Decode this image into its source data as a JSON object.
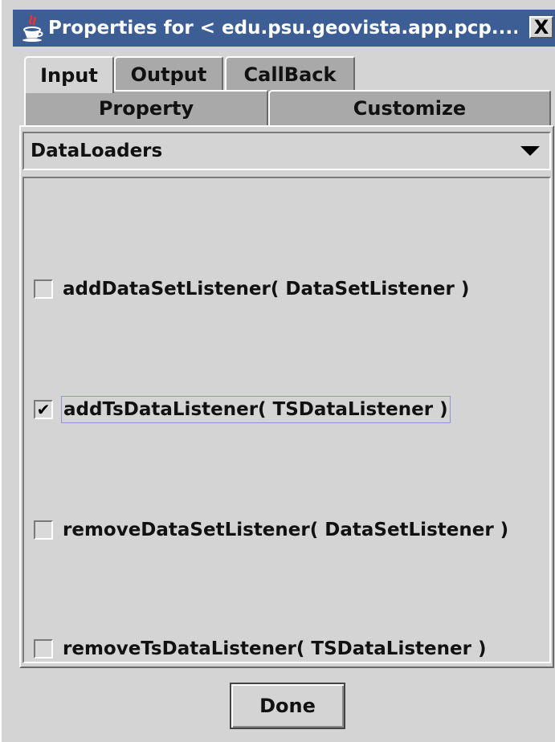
{
  "window": {
    "title": "Properties for < edu.psu.geovista.app.pcp....",
    "close_label": "X"
  },
  "tabs_row1": [
    {
      "label": "Input",
      "selected": true
    },
    {
      "label": "Output",
      "selected": false
    },
    {
      "label": "CallBack",
      "selected": false
    }
  ],
  "tabs_row2": [
    {
      "label": "Property",
      "selected": false
    },
    {
      "label": "Customize",
      "selected": false
    }
  ],
  "combo": {
    "selected": "DataLoaders"
  },
  "methods": [
    {
      "label": "addDataSetListener( DataSetListener )",
      "checked": false
    },
    {
      "label": "addTsDataListener( TSDataListener )",
      "checked": true,
      "focused": true
    },
    {
      "label": "removeDataSetListener( DataSetListener )",
      "checked": false
    },
    {
      "label": "removeTsDataListener( TSDataListener )",
      "checked": false
    }
  ],
  "checkmark": "✔",
  "done_label": "Done",
  "colors": {
    "titlebar": "#3c5e94",
    "background": "#d4d4d4",
    "inactive_tab": "#a9a9a9"
  }
}
